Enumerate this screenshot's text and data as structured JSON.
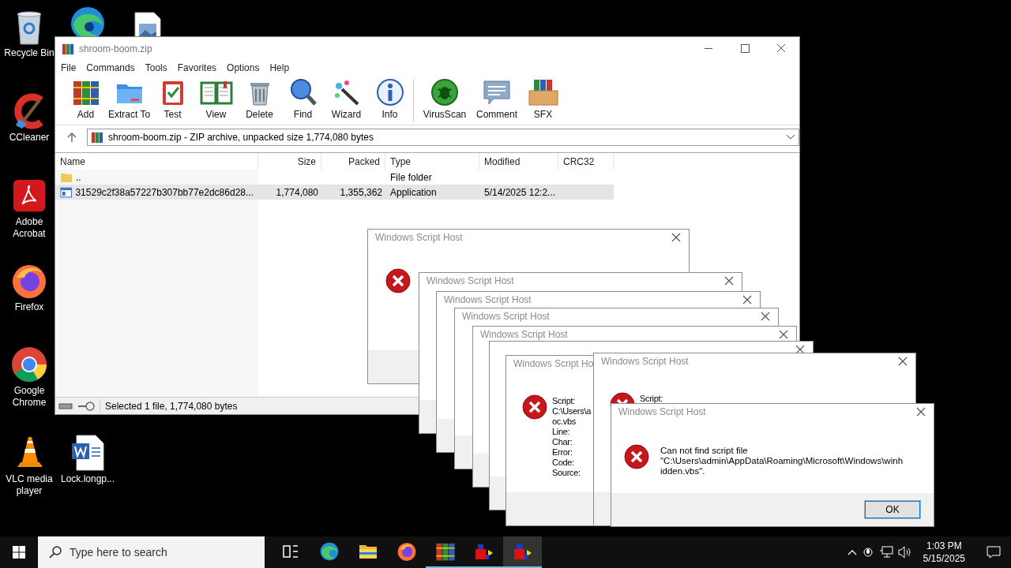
{
  "desktop_icons": [
    {
      "kind": "recycle",
      "label": "Recycle Bin"
    },
    {
      "kind": "edge"
    },
    {
      "kind": "image"
    },
    {
      "kind": "ccleaner",
      "label": "CCleaner"
    },
    {
      "kind": "pdf",
      "label": "Adobe Acrobat"
    },
    {
      "kind": "firefox",
      "label": "Firefox"
    },
    {
      "kind": "chrome",
      "label": "Google Chrome"
    },
    {
      "kind": "vlc",
      "label": "VLC media player"
    },
    {
      "kind": "word",
      "label": "Lock.longp..."
    }
  ],
  "archive_window": {
    "title": "shroom-boom.zip",
    "menu": [
      "File",
      "Commands",
      "Tools",
      "Favorites",
      "Options",
      "Help"
    ],
    "toolbar": [
      {
        "kind": "add",
        "label": "Add"
      },
      {
        "kind": "extract",
        "label": "Extract To"
      },
      {
        "kind": "test",
        "label": "Test"
      },
      {
        "kind": "view",
        "label": "View"
      },
      {
        "kind": "delete",
        "label": "Delete"
      },
      {
        "kind": "find",
        "label": "Find"
      },
      {
        "kind": "wizard",
        "label": "Wizard"
      },
      {
        "kind": "info",
        "label": "Info"
      },
      {
        "kind": "scan",
        "label": "VirusScan"
      },
      {
        "kind": "comment",
        "label": "Comment"
      },
      {
        "kind": "sfx",
        "label": "SFX"
      }
    ],
    "address": "shroom-boom.zip - ZIP archive, unpacked size 1,774,080 bytes",
    "columns": [
      "Name",
      "Size",
      "Packed",
      "Type",
      "Modified",
      "CRC32"
    ],
    "rows": [
      {
        "kind": "folder",
        "name": "..",
        "type": "File folder",
        "selected": false
      },
      {
        "kind": "app",
        "name": "31529c2f38a57227b307bb77e2dc86d28...",
        "size": "1,774,080",
        "packed": "1,355,362",
        "type": "Application",
        "modified": "5/14/2025 12:2...",
        "selected": true
      }
    ],
    "status": "Selected 1 file, 1,774,080 bytes"
  },
  "dialogs": [
    {
      "kind": "icon",
      "title": "Windows Script Host"
    },
    {
      "kind": "blank",
      "title": "Windows Script Host"
    },
    {
      "kind": "blank",
      "title": "Windows Script Host"
    },
    {
      "kind": "blank",
      "title": "Windows Script Host"
    },
    {
      "kind": "blank",
      "title": "Windows Script Host"
    },
    {
      "kind": "blank"
    },
    {
      "kind": "details",
      "title": "Windows Script Ho",
      "lines": [
        "Script:",
        "C:\\Users\\a",
        "oc.vbs",
        "Line:",
        "Char:",
        "Error:",
        "Code:",
        "Source:"
      ]
    },
    {
      "kind": "details",
      "title": "Windows Script Host",
      "lines": [
        "Script:"
      ]
    },
    {
      "kind": "message",
      "title": "Windows Script Host",
      "lines": [
        "Can not find script file",
        "\"C:\\Users\\admin\\AppData\\Roaming\\Microsoft\\Windows\\winh",
        "idden.vbs\"."
      ],
      "button": "OK"
    }
  ],
  "taskbar": {
    "search_placeholder": "Type here to search",
    "items": [
      {
        "kind": "taskview",
        "running": false,
        "selected": false
      },
      {
        "kind": "edge",
        "running": false,
        "selected": false
      },
      {
        "kind": "explorer",
        "running": false,
        "selected": false
      },
      {
        "kind": "firefox",
        "running": false,
        "selected": false
      },
      {
        "kind": "winrar",
        "running": true,
        "selected": false
      },
      {
        "kind": "app",
        "running": true,
        "selected": false
      },
      {
        "kind": "app",
        "running": true,
        "selected": true
      }
    ],
    "time": "1:03 PM",
    "date": "5/15/2025"
  }
}
